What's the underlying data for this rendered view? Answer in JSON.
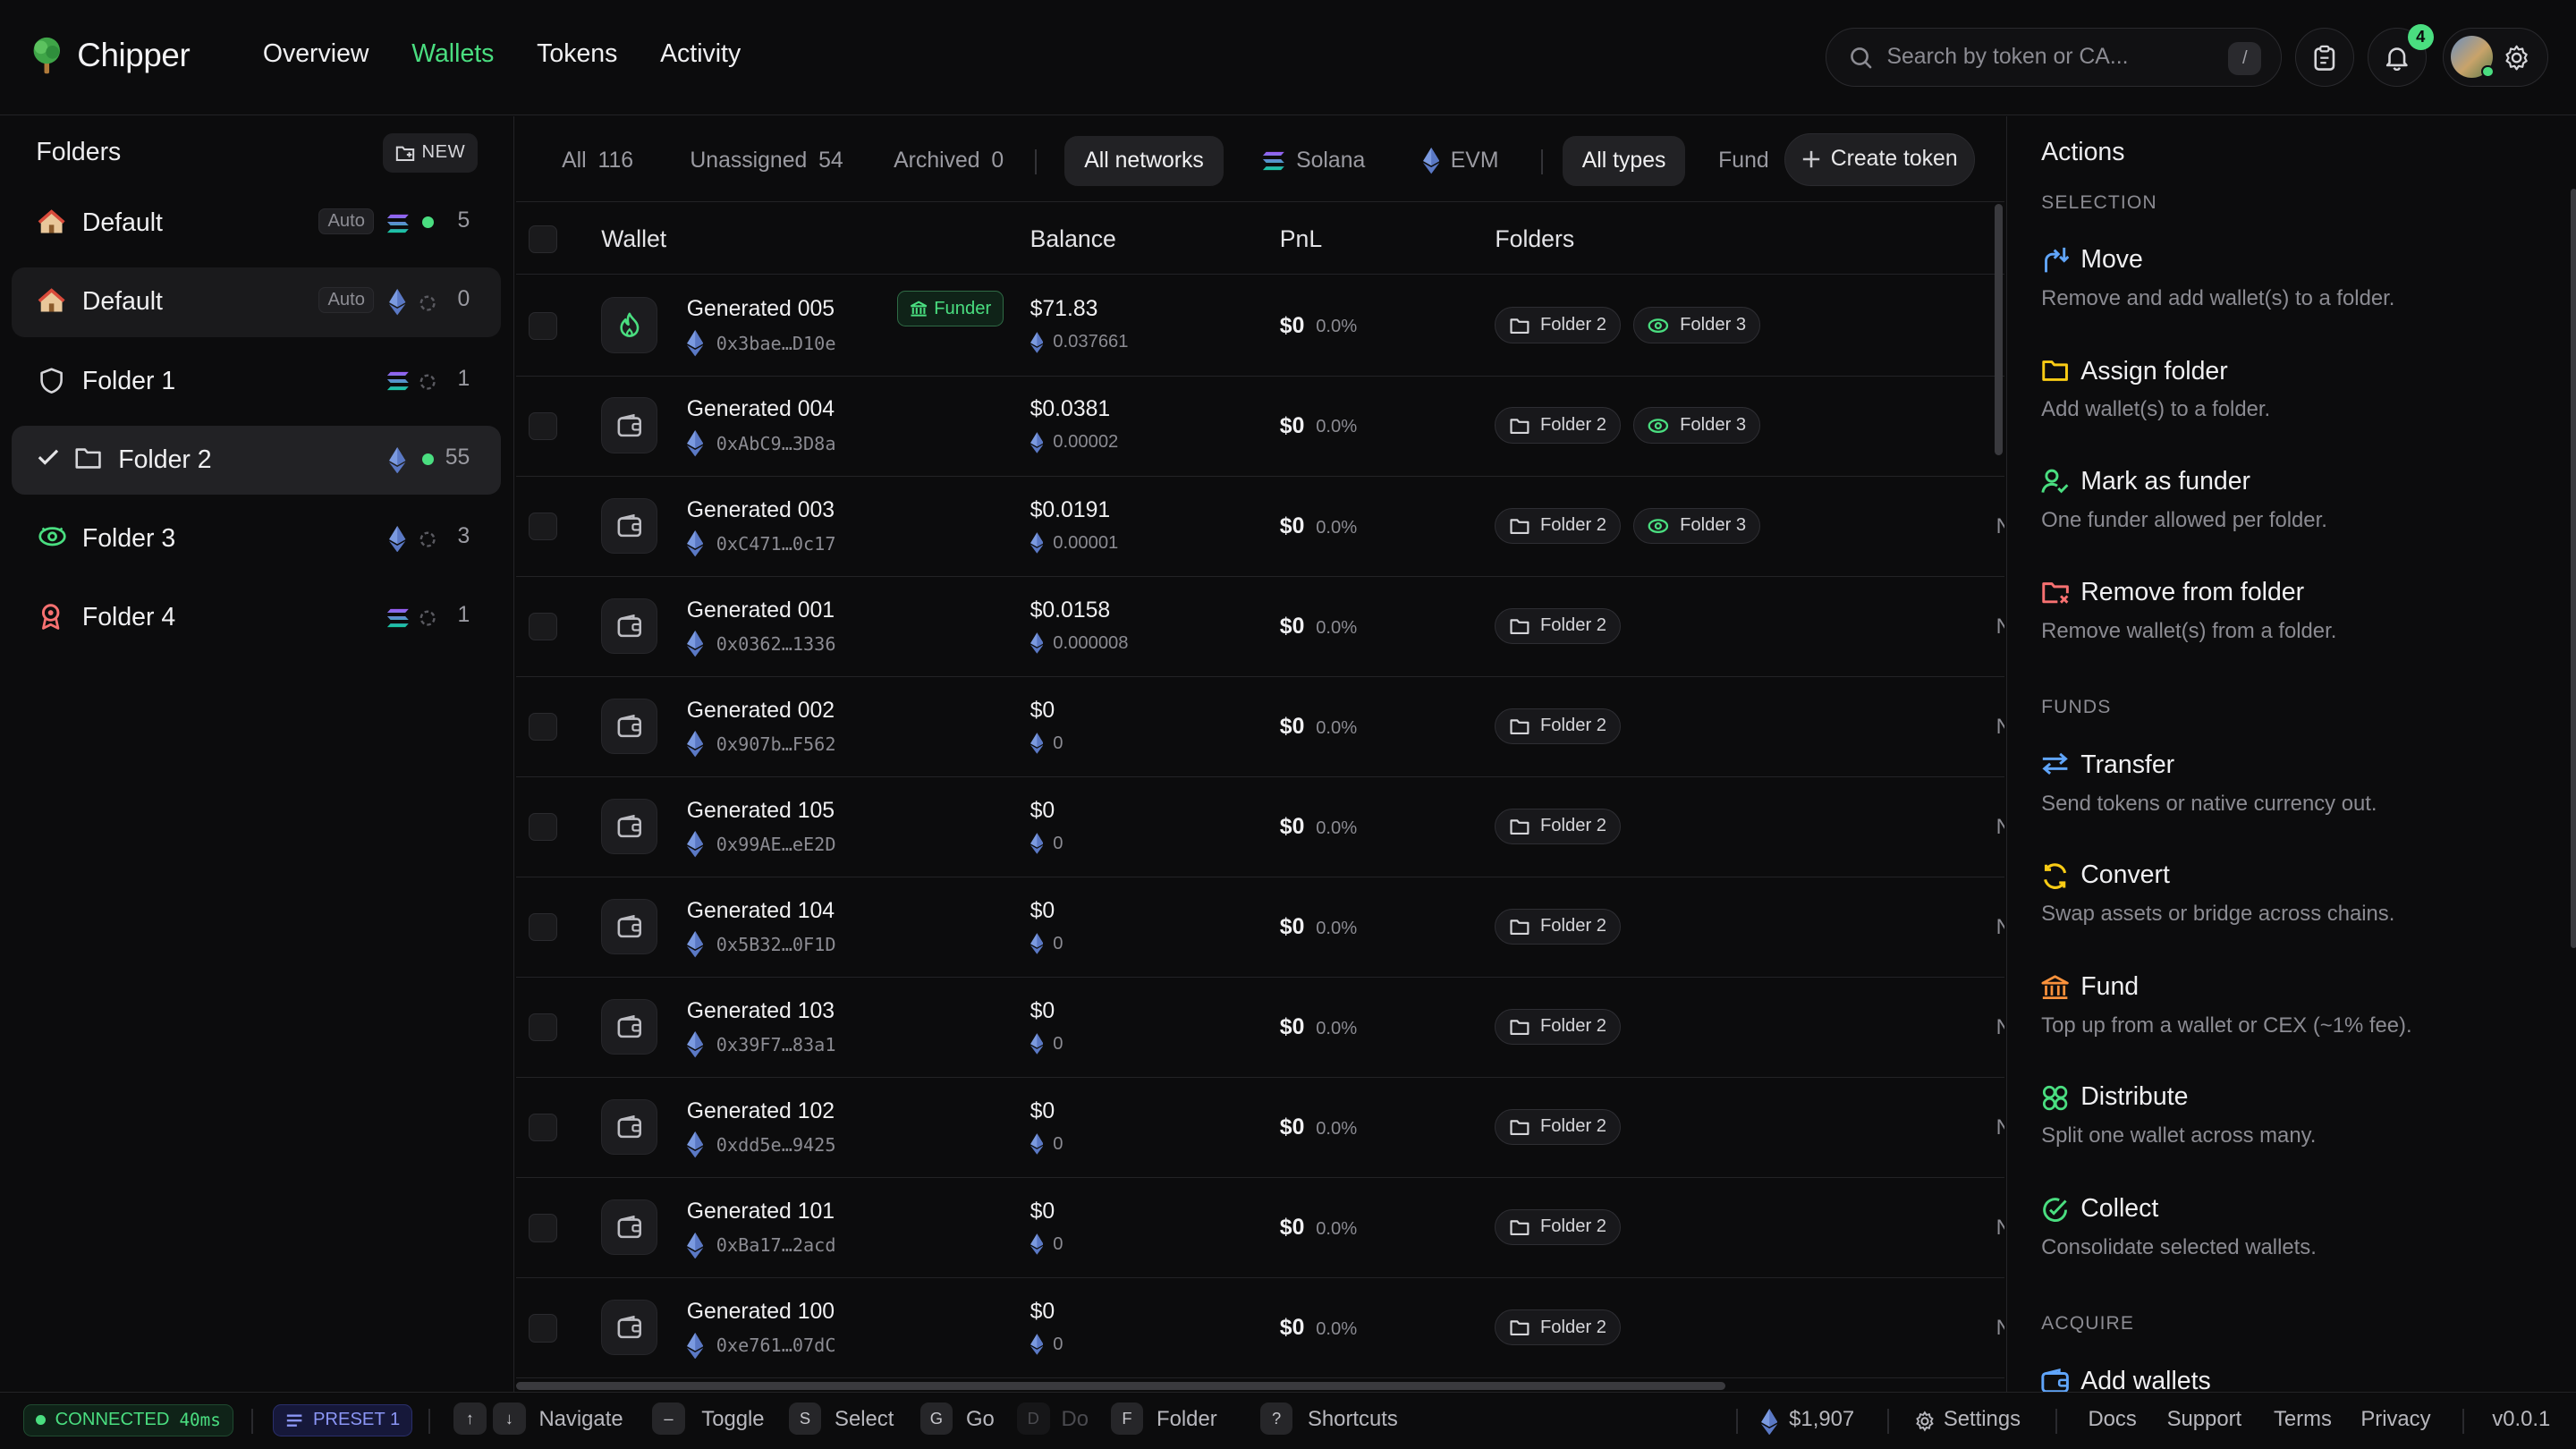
{
  "app": {
    "name": "Chipper"
  },
  "nav": {
    "items": [
      "Overview",
      "Wallets",
      "Tokens",
      "Activity"
    ],
    "active": "Wallets"
  },
  "search": {
    "placeholder": "Search by token or CA...",
    "shortcut": "/"
  },
  "notifications": {
    "count": "4"
  },
  "folders": {
    "title": "Folders",
    "new_label": "NEW",
    "items": [
      {
        "name": "Default",
        "auto": "Auto",
        "count": "5",
        "icon": "home-icon",
        "network": "solana",
        "status": "active"
      },
      {
        "name": "Default",
        "auto": "Auto",
        "count": "0",
        "icon": "home-icon",
        "network": "evm",
        "status": "idle"
      },
      {
        "name": "Folder 1",
        "count": "1",
        "icon": "shield-icon",
        "network": "solana",
        "status": "idle"
      },
      {
        "name": "Folder 2",
        "count": "55",
        "icon": "folder-icon",
        "network": "evm",
        "status": "active",
        "selected": true
      },
      {
        "name": "Folder 3",
        "count": "3",
        "icon": "eye-icon",
        "network": "evm",
        "status": "idle"
      },
      {
        "name": "Folder 4",
        "count": "1",
        "icon": "award-icon",
        "network": "solana",
        "status": "idle"
      }
    ]
  },
  "filters": {
    "all": {
      "label": "All",
      "count": "116"
    },
    "unassigned": {
      "label": "Unassigned",
      "count": "54"
    },
    "archived": {
      "label": "Archived",
      "count": "0"
    },
    "networks": [
      "All networks",
      "Solana",
      "EVM"
    ],
    "types": [
      "All types",
      "Fund"
    ],
    "create_label": "Create token"
  },
  "table": {
    "columns": [
      "Wallet",
      "Balance",
      "PnL",
      "Folders"
    ],
    "rows": [
      {
        "name": "Generated 005",
        "address": "0x3bae…D10e",
        "balance": "$71.83",
        "native": "0.037661",
        "pnl": "$0",
        "pct": "0.0%",
        "folders": [
          "Folder 2",
          "Folder 3"
        ],
        "funder": "Funder"
      },
      {
        "name": "Generated 004",
        "address": "0xAbC9…3D8a",
        "balance": "$0.0381",
        "native": "0.00002",
        "pnl": "$0",
        "pct": "0.0%",
        "folders": [
          "Folder 2",
          "Folder 3"
        ]
      },
      {
        "name": "Generated 003",
        "address": "0xC471…0c17",
        "balance": "$0.0191",
        "native": "0.00001",
        "pnl": "$0",
        "pct": "0.0%",
        "folders": [
          "Folder 2",
          "Folder 3"
        ],
        "edge": "N"
      },
      {
        "name": "Generated 001",
        "address": "0x0362…1336",
        "balance": "$0.0158",
        "native": "0.000008",
        "pnl": "$0",
        "pct": "0.0%",
        "folders": [
          "Folder 2"
        ],
        "edge": "N"
      },
      {
        "name": "Generated 002",
        "address": "0x907b…F562",
        "balance": "$0",
        "native": "0",
        "pnl": "$0",
        "pct": "0.0%",
        "folders": [
          "Folder 2"
        ],
        "edge": "N"
      },
      {
        "name": "Generated 105",
        "address": "0x99AE…eE2D",
        "balance": "$0",
        "native": "0",
        "pnl": "$0",
        "pct": "0.0%",
        "folders": [
          "Folder 2"
        ],
        "edge": "N"
      },
      {
        "name": "Generated 104",
        "address": "0x5B32…0F1D",
        "balance": "$0",
        "native": "0",
        "pnl": "$0",
        "pct": "0.0%",
        "folders": [
          "Folder 2"
        ],
        "edge": "N"
      },
      {
        "name": "Generated 103",
        "address": "0x39F7…83a1",
        "balance": "$0",
        "native": "0",
        "pnl": "$0",
        "pct": "0.0%",
        "folders": [
          "Folder 2"
        ],
        "edge": "N"
      },
      {
        "name": "Generated 102",
        "address": "0xdd5e…9425",
        "balance": "$0",
        "native": "0",
        "pnl": "$0",
        "pct": "0.0%",
        "folders": [
          "Folder 2"
        ],
        "edge": "N"
      },
      {
        "name": "Generated 101",
        "address": "0xBa17…2acd",
        "balance": "$0",
        "native": "0",
        "pnl": "$0",
        "pct": "0.0%",
        "folders": [
          "Folder 2"
        ],
        "edge": "N"
      },
      {
        "name": "Generated 100",
        "address": "0xe761…07dC",
        "balance": "$0",
        "native": "0",
        "pnl": "$0",
        "pct": "0.0%",
        "folders": [
          "Folder 2"
        ],
        "edge": "N"
      }
    ]
  },
  "actions": {
    "title": "Actions",
    "sections": [
      {
        "label": "SELECTION",
        "items": [
          {
            "name": "Move",
            "desc": "Remove and add wallet(s) to a folder.",
            "icon": "move-icon",
            "color": "#60a5fa"
          },
          {
            "name": "Assign folder",
            "desc": "Add wallet(s) to a folder.",
            "icon": "folder-icon",
            "color": "#facc15"
          },
          {
            "name": "Mark as funder",
            "desc": "One funder allowed per folder.",
            "icon": "user-check-icon",
            "color": "#4ade80"
          },
          {
            "name": "Remove from folder",
            "desc": "Remove wallet(s) from a folder.",
            "icon": "folder-x-icon",
            "color": "#f87171"
          }
        ]
      },
      {
        "label": "FUNDS",
        "items": [
          {
            "name": "Transfer",
            "desc": "Send tokens or native currency out.",
            "icon": "transfer-icon",
            "color": "#60a5fa"
          },
          {
            "name": "Convert",
            "desc": "Swap assets or bridge across chains.",
            "icon": "convert-icon",
            "color": "#facc15"
          },
          {
            "name": "Fund",
            "desc": "Top up from a wallet or CEX (~1% fee).",
            "icon": "bank-icon",
            "color": "#fb923c"
          },
          {
            "name": "Distribute",
            "desc": "Split one wallet across many.",
            "icon": "distribute-icon",
            "color": "#4ade80"
          },
          {
            "name": "Collect",
            "desc": "Consolidate selected wallets.",
            "icon": "collect-icon",
            "color": "#4ade80"
          }
        ]
      },
      {
        "label": "ACQUIRE",
        "items": [
          {
            "name": "Add wallets",
            "desc": "",
            "icon": "wallet-add-icon",
            "color": "#60a5fa"
          }
        ]
      }
    ]
  },
  "statusbar": {
    "connected": "CONNECTED",
    "latency": "40ms",
    "preset": "PRESET 1",
    "shortcuts": [
      {
        "keys": [
          "↑",
          "↓"
        ],
        "label": "Navigate"
      },
      {
        "keys": [
          "–"
        ],
        "label": "Toggle"
      },
      {
        "keys": [
          "S"
        ],
        "label": "Select"
      },
      {
        "keys": [
          "G"
        ],
        "label": "Go"
      },
      {
        "keys": [
          "D"
        ],
        "label": "Do",
        "dim": true
      },
      {
        "keys": [
          "F"
        ],
        "label": "Folder"
      },
      {
        "keys": [
          "?"
        ],
        "label": "Shortcuts"
      }
    ],
    "eth_price": "$1,907",
    "settings": "Settings",
    "links": [
      "Docs",
      "Support",
      "Terms",
      "Privacy"
    ],
    "version": "v0.0.1"
  },
  "colors": {
    "accent": "#4ade80",
    "solana_top": "#9b5cf6",
    "solana_bottom": "#14c8a0",
    "eth": "#6f8fd8"
  }
}
